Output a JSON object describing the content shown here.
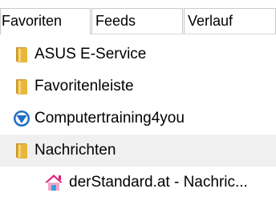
{
  "tabs": [
    {
      "label": "Favoriten",
      "active": true
    },
    {
      "label": "Feeds",
      "active": false
    },
    {
      "label": "Verlauf",
      "active": false
    }
  ],
  "items": [
    {
      "label": "ASUS E-Service",
      "icon": "folder-icon",
      "type": "folder"
    },
    {
      "label": "Favoritenleiste",
      "icon": "folder-icon",
      "type": "folder"
    },
    {
      "label": "Computertraining4you",
      "icon": "site-shield-icon",
      "type": "link"
    },
    {
      "label": "Nachrichten",
      "icon": "folder-icon",
      "type": "folder",
      "highlighted": true
    },
    {
      "label": "derStandard.at - Nachric...",
      "icon": "feed-home-icon",
      "type": "link",
      "indent": 1
    }
  ],
  "colors": {
    "folder": "#e8b73a",
    "folder_dark": "#c9962a",
    "shield": "#1f6fc4",
    "highlight": "#f0f0f0",
    "feed_roof": "#e0217d"
  }
}
